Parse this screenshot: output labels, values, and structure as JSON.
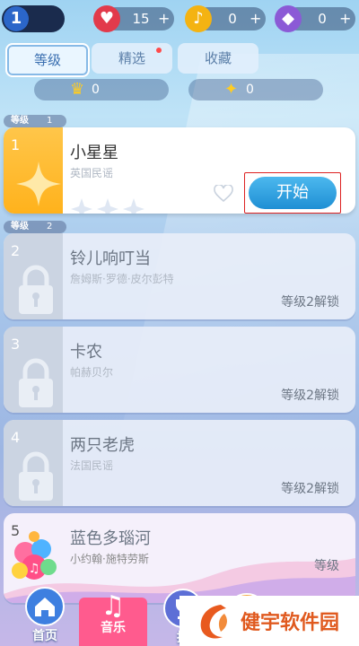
{
  "topbar": {
    "level": "1",
    "hearts": {
      "icon": "heart-icon",
      "value": "15",
      "plus": "+"
    },
    "notes": {
      "icon": "music-note-icon",
      "value": "0",
      "plus": "+"
    },
    "gems": {
      "icon": "diamond-icon",
      "value": "0",
      "plus": "+"
    }
  },
  "tabs": [
    {
      "label": "等级",
      "active": true
    },
    {
      "label": "精选",
      "active": false,
      "has_dot": true
    },
    {
      "label": "收藏",
      "active": false
    }
  ],
  "stats": {
    "crown": "0",
    "star": "0"
  },
  "sections": [
    {
      "label": "等级",
      "level": "1"
    },
    {
      "label": "等级",
      "level": "2"
    }
  ],
  "songs": [
    {
      "index": "1",
      "title": "小星星",
      "artist": "英国民谣",
      "locked": false,
      "button": "开始",
      "stars": 3
    },
    {
      "index": "2",
      "title": "铃儿响叮当",
      "artist": "詹姆斯·罗德·皮尔彭特",
      "locked": true,
      "unlock_text": "等级2解锁"
    },
    {
      "index": "3",
      "title": "卡农",
      "artist": "帕赫贝尔",
      "locked": true,
      "unlock_text": "等级2解锁"
    },
    {
      "index": "4",
      "title": "两只老虎",
      "artist": "法国民谣",
      "locked": true,
      "unlock_text": "等级2解锁"
    },
    {
      "index": "5",
      "title": "蓝色多瑙河",
      "artist": "小约翰·施特劳斯",
      "locked": true,
      "unlock_text": "等级"
    }
  ],
  "nav": [
    {
      "label": "首页",
      "icon": "home-icon"
    },
    {
      "label": "音乐",
      "icon": "music-note-icon",
      "active": true
    },
    {
      "label": "挑",
      "icon": "trophy-icon"
    },
    {
      "label": "",
      "icon": "cart-icon"
    }
  ],
  "watermark": "健宇软件园",
  "colors": {
    "accent": "#1f8fd4",
    "gold": "#ffb21c",
    "badge": "#ff4b4b"
  }
}
